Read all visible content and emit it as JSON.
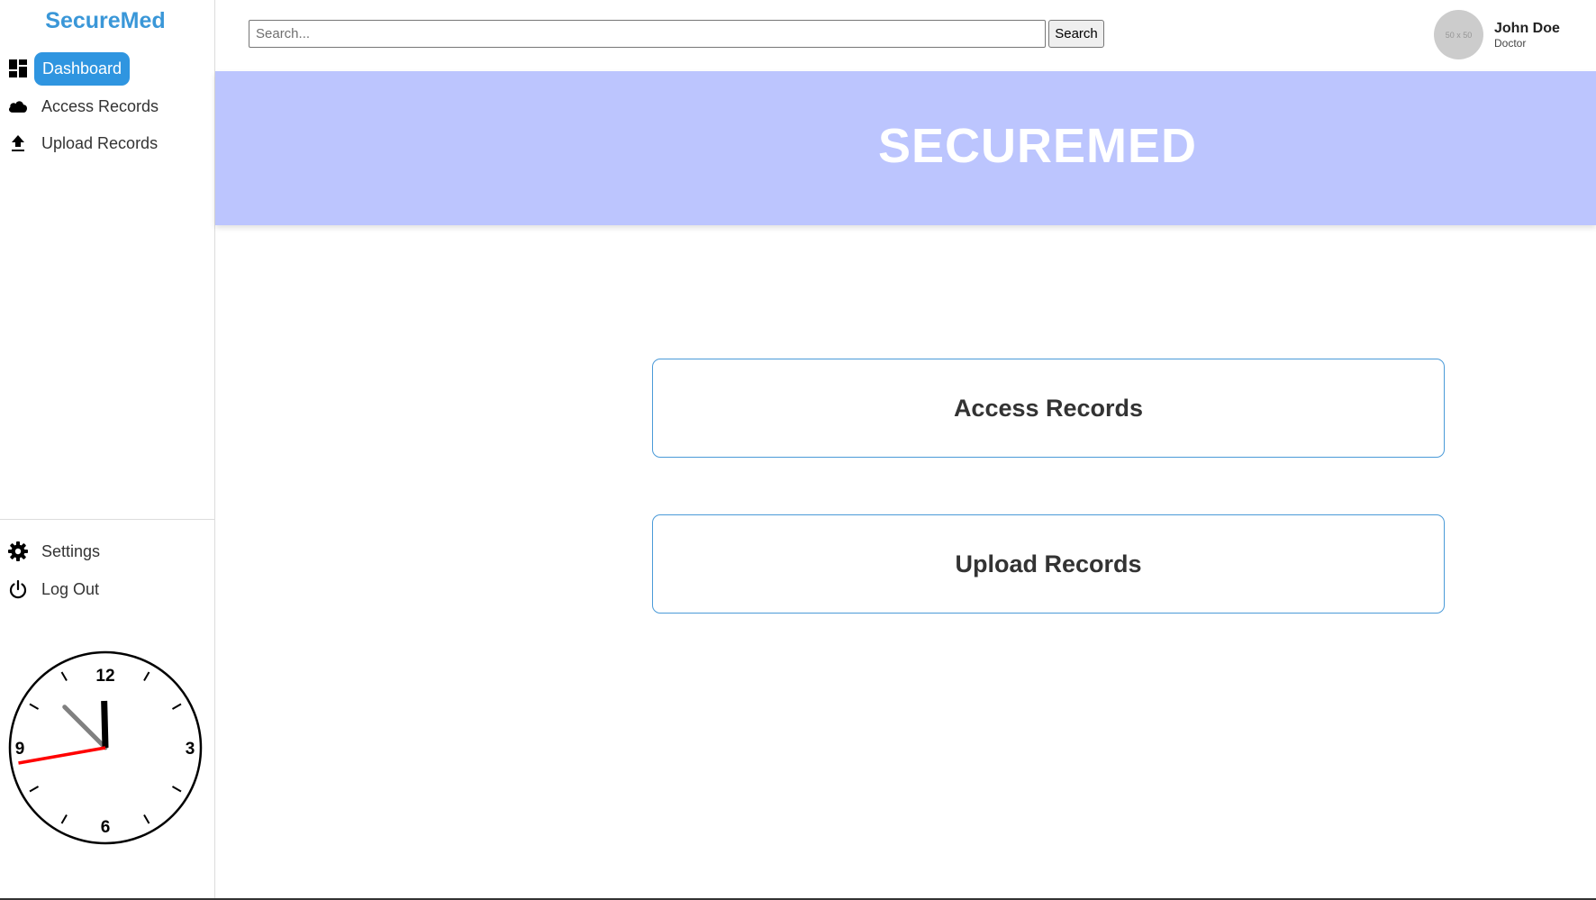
{
  "sidebar": {
    "brand": "SecureMed",
    "nav": [
      {
        "label": "Dashboard",
        "icon": "dashboard-icon",
        "active": true
      },
      {
        "label": "Access Records",
        "icon": "cloud-icon"
      },
      {
        "label": "Upload Records",
        "icon": "upload-icon"
      }
    ],
    "bottom_nav": [
      {
        "label": "Settings",
        "icon": "gear-icon"
      },
      {
        "label": "Log Out",
        "icon": "power-icon"
      }
    ],
    "clock": {
      "numerals": [
        "12",
        "3",
        "6",
        "9"
      ],
      "time": {
        "hour": 11,
        "minute": 57,
        "second": 45
      },
      "second_hand_color": "#ff0000"
    }
  },
  "topbar": {
    "search_placeholder": "Search...",
    "search_value": "",
    "search_button": "Search",
    "avatar_text": "50 x 50",
    "user_name": "John Doe",
    "user_role": "Doctor"
  },
  "banner": {
    "title": "SECUREMED",
    "color": "#bcc5fe"
  },
  "cards": [
    {
      "label": "Access Records"
    },
    {
      "label": "Upload Records"
    }
  ],
  "colors": {
    "accent": "#2f95e0",
    "brand": "#3a97d8"
  }
}
